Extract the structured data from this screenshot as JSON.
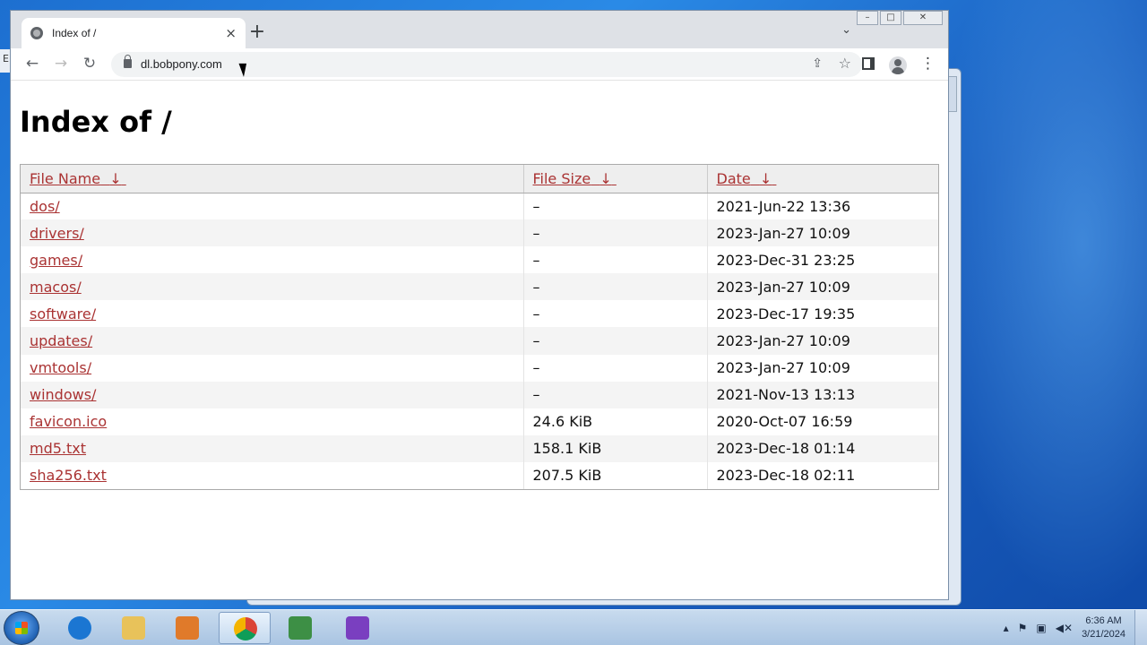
{
  "browser": {
    "tab_title": "Index of /",
    "tab_close": "×",
    "new_tab": "+",
    "url": "dl.bobpony.com",
    "window_controls": {
      "minimize": "–",
      "maximize": "□",
      "close": "✕"
    }
  },
  "page": {
    "heading": "Index of /",
    "columns": [
      "File Name",
      "File Size",
      "Date"
    ],
    "sort_indicator": "↓",
    "rows": [
      {
        "name": "dos/",
        "size": "–",
        "date": "2021-Jun-22 13:36"
      },
      {
        "name": "drivers/",
        "size": "–",
        "date": "2023-Jan-27 10:09"
      },
      {
        "name": "games/",
        "size": "–",
        "date": "2023-Dec-31 23:25"
      },
      {
        "name": "macos/",
        "size": "–",
        "date": "2023-Jan-27 10:09"
      },
      {
        "name": "software/",
        "size": "–",
        "date": "2023-Dec-17 19:35"
      },
      {
        "name": "updates/",
        "size": "–",
        "date": "2023-Jan-27 10:09"
      },
      {
        "name": "vmtools/",
        "size": "–",
        "date": "2023-Jan-27 10:09"
      },
      {
        "name": "windows/",
        "size": "–",
        "date": "2021-Nov-13 13:13"
      },
      {
        "name": "favicon.ico",
        "size": "24.6 KiB",
        "date": "2020-Oct-07 16:59"
      },
      {
        "name": "md5.txt",
        "size": "158.1 KiB",
        "date": "2023-Dec-18 01:14"
      },
      {
        "name": "sha256.txt",
        "size": "207.5 KiB",
        "date": "2023-Dec-18 02:11"
      }
    ]
  },
  "taskbar": {
    "apps": [
      {
        "icon": "internet-explorer-icon",
        "color": "#1b76d2"
      },
      {
        "icon": "file-explorer-icon",
        "color": "#e8c25a"
      },
      {
        "icon": "media-player-icon",
        "color": "#e07a2a"
      },
      {
        "icon": "chrome-icon",
        "color": "#db4437",
        "active": true
      },
      {
        "icon": "task-manager-icon",
        "color": "#3d8f45"
      },
      {
        "icon": "paint-icon",
        "color": "#7a3fc0"
      }
    ],
    "time": "6:36 AM",
    "date": "3/21/2024"
  },
  "colors": {
    "link": "#aa3333",
    "header_bg": "#eeeeee"
  }
}
